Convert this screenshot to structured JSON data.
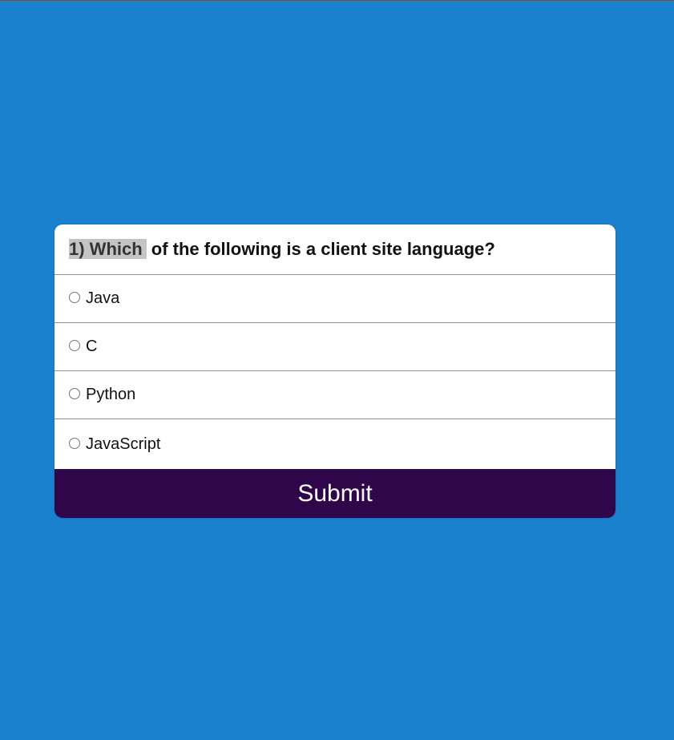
{
  "quiz": {
    "question_number_highlight": "1) Which",
    "question_rest": " of the following is a client site language?",
    "options": [
      {
        "label": "Java",
        "selected": false
      },
      {
        "label": "C",
        "selected": false
      },
      {
        "label": "Python",
        "selected": false
      },
      {
        "label": "JavaScript",
        "selected": false
      }
    ],
    "submit_label": "Submit"
  },
  "colors": {
    "background": "#1a81cf",
    "card": "#ffffff",
    "submit_bg": "#30064a",
    "highlight": "#c4c4c4"
  }
}
